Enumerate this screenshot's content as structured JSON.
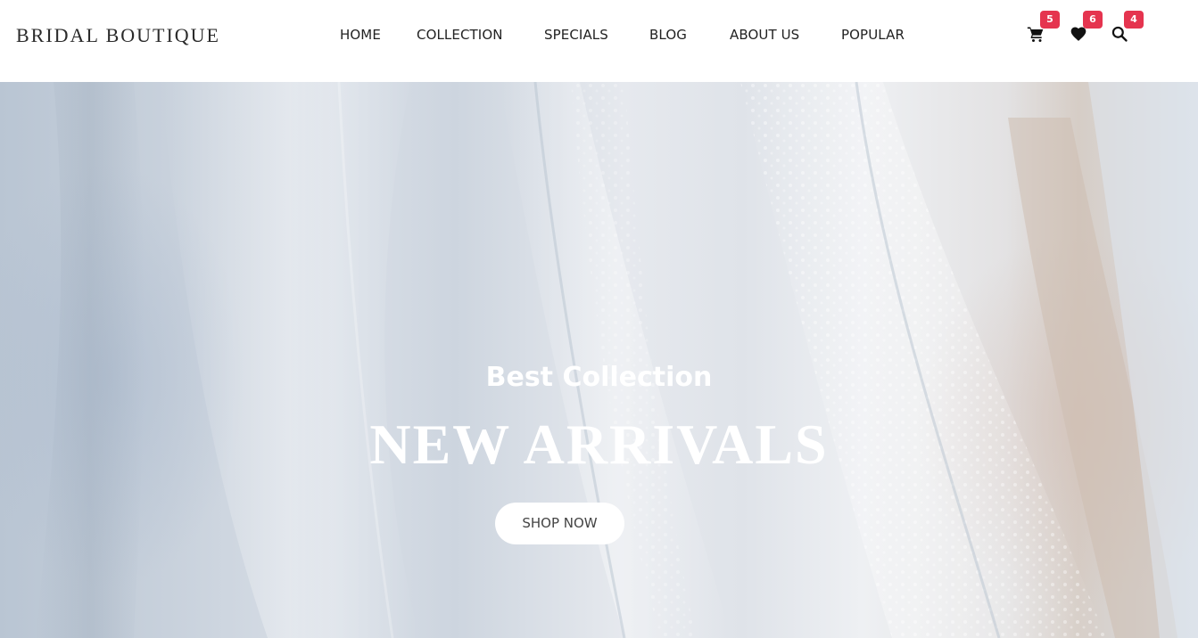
{
  "header": {
    "logo": "BRIDAL BOUTIQUE",
    "nav": [
      {
        "label": "HOME"
      },
      {
        "label": "COLLECTION"
      },
      {
        "label": "SPECIALS"
      },
      {
        "label": "BLOG"
      },
      {
        "label": "ABOUT US"
      },
      {
        "label": "POPULAR"
      }
    ],
    "icons": {
      "cart": {
        "icon": "cart-icon",
        "count": "5"
      },
      "wishlist": {
        "icon": "heart-icon",
        "count": "6"
      },
      "search": {
        "icon": "search-icon",
        "count": "4"
      }
    }
  },
  "hero": {
    "subtitle": "Best Collection",
    "title": "NEW ARRIVALS",
    "button_label": "SHOP NOW"
  },
  "colors": {
    "badge": "#e5344f",
    "text_dark": "#222222",
    "hero_text": "#ffffff"
  }
}
